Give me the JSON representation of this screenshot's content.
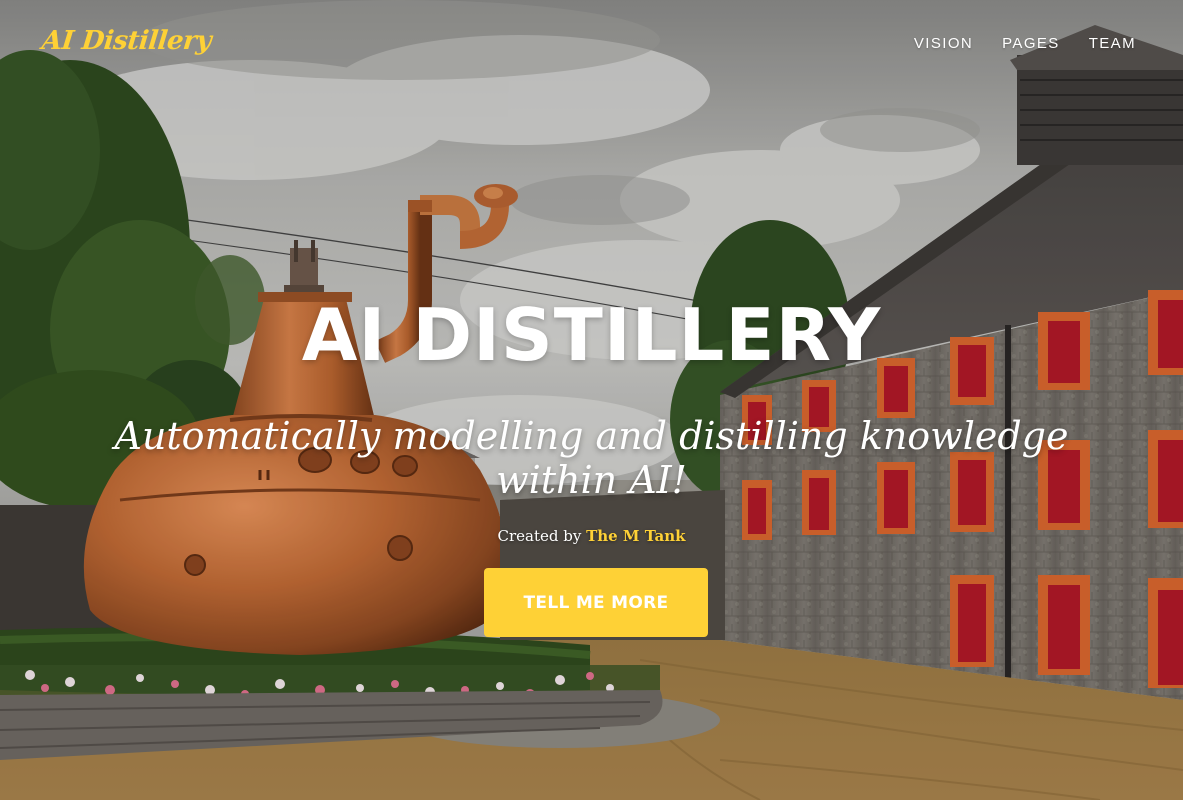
{
  "colors": {
    "accent": "#fed136",
    "text": "#ffffff"
  },
  "navbar": {
    "brand": "AI Distillery",
    "links": [
      "VISION",
      "PAGES",
      "TEAM"
    ]
  },
  "intro": {
    "heading": "AI DISTILLERY",
    "lead": "Automatically modelling and distilling knowledge within AI!",
    "credit_prefix": "Created by",
    "credit_link": "The M Tank",
    "cta_label": "TELL ME MORE"
  }
}
